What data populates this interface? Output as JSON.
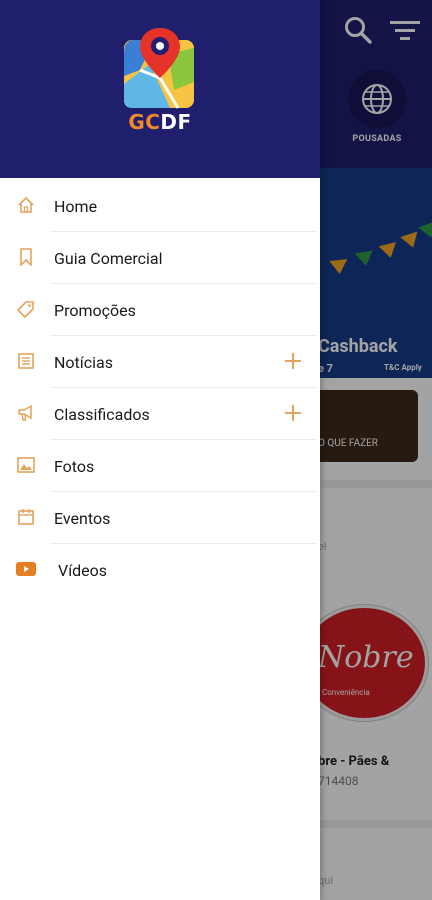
{
  "background_app": {
    "pousadas_label": "POUSADAS",
    "banner_title": "Cashback",
    "banner_sub": "e 7",
    "banner_tc": "T&C Apply",
    "oquefazer_label": "O QUE FAZER",
    "card_hint": "el",
    "logo_text": "Nobre",
    "logo_sub": "Conveniência",
    "card_name": "bre - Pães &",
    "card_phone": "714408",
    "card2_hint": "qui"
  },
  "drawer": {
    "brand_gc": "GC",
    "brand_df": "DF",
    "menu": [
      {
        "label": "Home",
        "icon": "home-icon",
        "expandable": false
      },
      {
        "label": "Guia Comercial",
        "icon": "bookmark-icon",
        "expandable": false
      },
      {
        "label": "Promoções",
        "icon": "tag-icon",
        "expandable": false
      },
      {
        "label": "Notícias",
        "icon": "newspaper-icon",
        "expandable": true
      },
      {
        "label": "Classificados",
        "icon": "megaphone-icon",
        "expandable": true
      },
      {
        "label": "Fotos",
        "icon": "photo-icon",
        "expandable": false
      },
      {
        "label": "Eventos",
        "icon": "calendar-icon",
        "expandable": false
      },
      {
        "label": "Vídeos",
        "icon": "youtube-icon",
        "expandable": false
      }
    ]
  },
  "colors": {
    "primary_navy": "#1f1f6e",
    "accent_orange": "#f0892c",
    "icon_orange": "#e3a35a",
    "youtube_orange": "#e67e22"
  }
}
